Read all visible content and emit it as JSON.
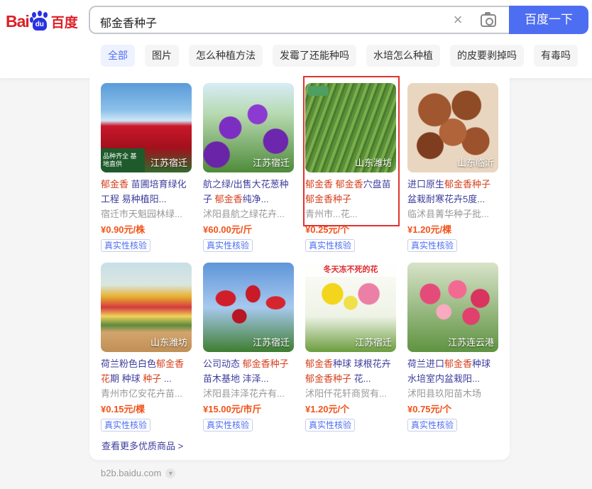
{
  "search": {
    "query": "郁金香种子",
    "button_label": "百度一下"
  },
  "logo": {
    "text_bai": "Bai",
    "text_du": "du",
    "text_cn": "百度"
  },
  "tabs": [
    {
      "label": "全部",
      "active": true
    },
    {
      "label": "图片"
    },
    {
      "label": "怎么种植方法"
    },
    {
      "label": "发霉了还能种吗"
    },
    {
      "label": "水培怎么种植"
    },
    {
      "label": "的皮要剥掉吗"
    },
    {
      "label": "有毒吗"
    }
  ],
  "products": [
    {
      "location": "江苏宿迁",
      "title_parts": [
        {
          "t": "郁金香",
          "hl": true
        },
        {
          "t": " 苗圃培育绿化工程 易种植阳...",
          "hl": false
        }
      ],
      "shop": "宿迁市天魁园林绿...",
      "price": "¥0.90元/株",
      "badge": "真实性核验",
      "img_tag": "品种齐全 基地直供"
    },
    {
      "location": "江苏宿迁",
      "title_parts": [
        {
          "t": "航之绿/出售大花葱种子 ",
          "hl": false
        },
        {
          "t": "郁金香",
          "hl": true
        },
        {
          "t": "纯净...",
          "hl": false
        }
      ],
      "shop": "沭阳县航之绿花卉...",
      "price": "¥60.00元/斤",
      "badge": "真实性核验"
    },
    {
      "location": "山东潍坊",
      "title_parts": [
        {
          "t": "郁金香",
          "hl": true
        },
        {
          "t": " ",
          "hl": false
        },
        {
          "t": "郁金香",
          "hl": true
        },
        {
          "t": "穴盘苗 ",
          "hl": false
        },
        {
          "t": "郁金香种子",
          "hl": true
        }
      ],
      "shop": "青州市...花...",
      "price": "¥0.25元/个",
      "badge": "真实性核验"
    },
    {
      "location": "山东临沂",
      "title_parts": [
        {
          "t": "进口原生",
          "hl": false
        },
        {
          "t": "郁金香种子",
          "hl": true
        },
        {
          "t": " 盆栽耐寒花卉5度...",
          "hl": false
        }
      ],
      "shop": "临沭县菁华种子批...",
      "price": "¥1.20元/棵",
      "badge": "真实性核验"
    },
    {
      "location": "山东潍坊",
      "title_parts": [
        {
          "t": "荷兰粉色白色",
          "hl": false
        },
        {
          "t": "郁金香花",
          "hl": true
        },
        {
          "t": "期 种球 ",
          "hl": false
        },
        {
          "t": "种子",
          "hl": true
        },
        {
          "t": " ...",
          "hl": false
        }
      ],
      "shop": "青州市亿安花卉苗...",
      "price": "¥0.15元/棵",
      "badge": "真实性核验"
    },
    {
      "location": "江苏宿迁",
      "title_parts": [
        {
          "t": "公司动态 ",
          "hl": false
        },
        {
          "t": "郁金香种子",
          "hl": true
        },
        {
          "t": " 苗木基地 沣泽...",
          "hl": false
        }
      ],
      "shop": "沭阳县沣泽花卉有...",
      "price": "¥15.00元/市斤",
      "badge": "真实性核验"
    },
    {
      "location": "江苏宿迁",
      "title_parts": [
        {
          "t": "郁金香",
          "hl": true
        },
        {
          "t": "种球 球根花卉 ",
          "hl": false
        },
        {
          "t": "郁金香种子",
          "hl": true
        },
        {
          "t": " 花...",
          "hl": false
        }
      ],
      "shop": "沭阳仟花轩商贸有...",
      "price": "¥1.20元/个",
      "badge": "真实性核验",
      "img_banner": "冬天冻不死的花"
    },
    {
      "location": "江苏连云港",
      "title_parts": [
        {
          "t": "荷兰进口",
          "hl": false
        },
        {
          "t": "郁金香",
          "hl": true
        },
        {
          "t": "种球 水培室内盆栽阳...",
          "hl": false
        }
      ],
      "shop": "沭阳县玖阳苗木场",
      "price": "¥0.75元/个",
      "badge": "真实性核验"
    }
  ],
  "more_link": "查看更多优质商品 >",
  "footer": {
    "domain": "b2b.baidu.com"
  },
  "colors": {
    "accent": "#4e6ef2",
    "price": "#f35219",
    "highlight": "#d6411f",
    "box": "#e0332e"
  }
}
